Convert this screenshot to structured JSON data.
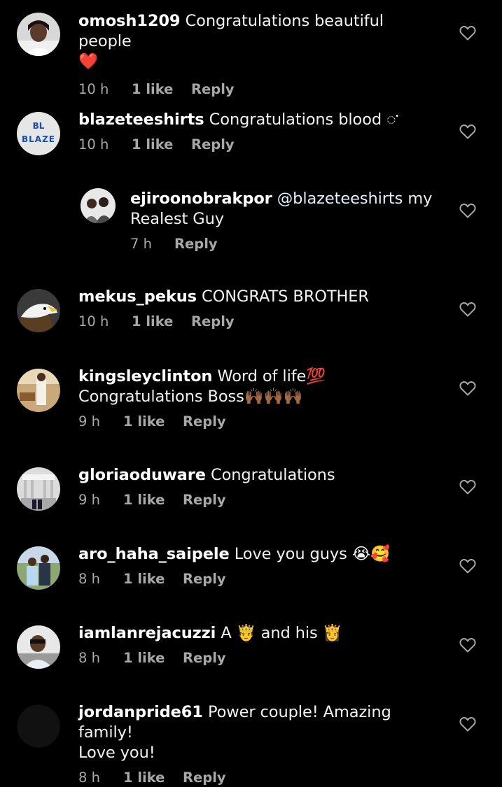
{
  "comments": [
    {
      "username": "omosh1209",
      "text": "Congratulations beautiful people\n❤️",
      "time": "10 h",
      "likes": "1 like",
      "reply": "Reply",
      "avatar_icon": "profile-photo-woman"
    },
    {
      "username": "blazeteeshirts",
      "text": "Congratulations blood 𑀀",
      "time": "10 h",
      "likes": "1 like",
      "reply": "Reply",
      "avatar_icon": "blaze-logo",
      "avatar_text": "BLAZE",
      "avatar_mark": "BL"
    },
    {
      "username": "ejiroonobrakpor",
      "mention": "@blazeteeshirts",
      "text": "my\nRealest Guy",
      "time": "7 h",
      "reply": "Reply",
      "avatar_icon": "profile-photo-group"
    },
    {
      "username": "mekus_pekus",
      "text": "CONGRATS BROTHER",
      "time": "10 h",
      "likes": "1 like",
      "reply": "Reply",
      "avatar_icon": "eagle-photo"
    },
    {
      "username": "kingsleyclinton",
      "text": "Word of life💯\nCongratulations Boss🙌🏾🙌🏾🙌🏾",
      "time": "9 h",
      "likes": "1 like",
      "reply": "Reply",
      "avatar_icon": "profile-photo-man"
    },
    {
      "username": "gloriaoduware",
      "text": "Congratulations",
      "time": "9 h",
      "likes": "1 like",
      "reply": "Reply",
      "avatar_icon": "monument-photo"
    },
    {
      "username": "aro_haha_saipele",
      "text": "Love you guys 😭🥰",
      "time": "8 h",
      "likes": "1 like",
      "reply": "Reply",
      "avatar_icon": "family-photo"
    },
    {
      "username": "iamlanrejacuzzi",
      "text": "A 🤴 and his 👸",
      "time": "8 h",
      "likes": "1 like",
      "reply": "Reply",
      "avatar_icon": "profile-photo-man-sunglasses"
    },
    {
      "username": "jordanpride61",
      "text": "Power couple! Amazing family!\nLove you!",
      "time": "8 h",
      "likes": "1 like",
      "reply": "Reply",
      "avatar_icon": "dark-avatar"
    }
  ],
  "colors": {
    "background": "#000000",
    "text": "#f2f2f2",
    "meta": "#a8a8a8",
    "mention": "#e0f1ff",
    "heart_red": "#e8213a"
  },
  "icons": {
    "like": "heart-outline-icon"
  }
}
